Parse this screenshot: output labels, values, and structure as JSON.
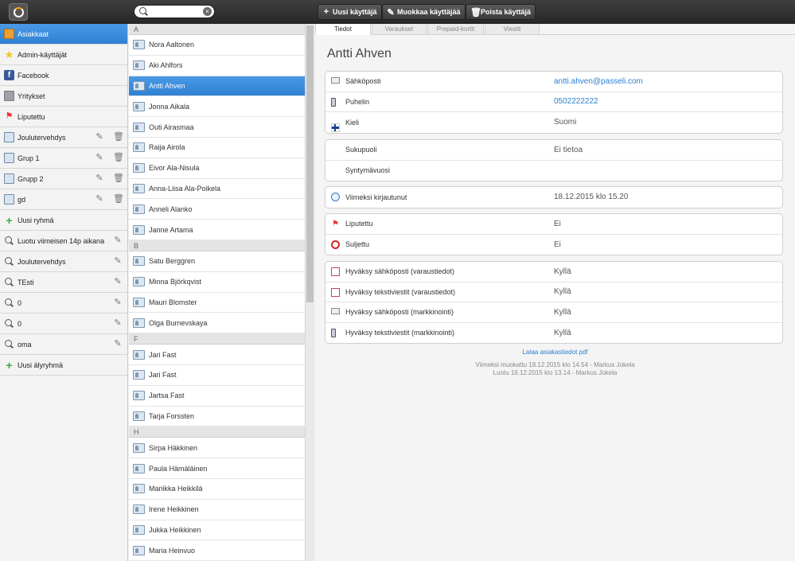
{
  "toolbar": {
    "search_placeholder": "",
    "search_value": "",
    "clear": "×",
    "new_user": "Uusi käyttäjä",
    "edit_user": "Muokkaa käyttäjää",
    "delete_user": "Poista käyttäjä"
  },
  "sidebar": {
    "items": [
      {
        "label": "Asiakkaat",
        "icon": "address-book-icon"
      },
      {
        "label": "Admin-käyttäjät",
        "icon": "star-icon"
      },
      {
        "label": "Facebook",
        "icon": "facebook-icon"
      },
      {
        "label": "Yritykset",
        "icon": "building-icon"
      },
      {
        "label": "Liputettu",
        "icon": "flag-icon"
      },
      {
        "label": "Joulutervehdys",
        "icon": "group-icon"
      },
      {
        "label": "Grup 1",
        "icon": "group-icon"
      },
      {
        "label": "Grupp 2",
        "icon": "group-icon"
      },
      {
        "label": "gd",
        "icon": "group-icon"
      },
      {
        "label": "Uusi ryhmä",
        "icon": "plus-icon"
      },
      {
        "label": "Luotu viimeisen 14p aikana",
        "icon": "magnifier-icon"
      },
      {
        "label": "Joulutervehdys",
        "icon": "magnifier-icon"
      },
      {
        "label": "TEsti",
        "icon": "magnifier-icon"
      },
      {
        "label": "0",
        "icon": "magnifier-icon"
      },
      {
        "label": "0",
        "icon": "magnifier-icon"
      },
      {
        "label": "oma",
        "icon": "magnifier-icon"
      },
      {
        "label": "Uusi älyryhmä",
        "icon": "plus-icon"
      }
    ]
  },
  "contacts": {
    "groups": [
      {
        "letter": "A",
        "names": [
          "Nora Aaltonen",
          "Aki Ahlfors",
          "Antti Ahven",
          "Jonna Aikala",
          "Outi Airasmaa",
          "Raija Airola",
          "Eivor Ala-Nisula",
          "Anna-Liisa Ala-Poikela",
          "Anneli Alanko",
          "Janne Artama"
        ]
      },
      {
        "letter": "B",
        "names": [
          "Satu Berggren",
          "Minna Björkqvist",
          "Mauri Blomster",
          "Olga Burnevskaya"
        ]
      },
      {
        "letter": "F",
        "names": [
          "Jari Fast",
          "Jari Fast",
          "Jartsa Fast",
          "Tarja Forssten"
        ]
      },
      {
        "letter": "H",
        "names": [
          "Sirpa Häkkinen",
          "Paula Hämäläinen",
          "Mariikka Heikkilä",
          "Irene Heikkinen",
          "Jukka Heikkinen",
          "Maria Heinvuo"
        ]
      }
    ],
    "selected": "Antti Ahven"
  },
  "tabs": [
    "Tiedot",
    "Varaukset",
    "Prepaid-kortit",
    "Viestit"
  ],
  "detail": {
    "name": "Antti Ahven",
    "contact": [
      {
        "label": "Sähköposti",
        "value": "antti.ahven@passeli.com",
        "icon": "mail-icon"
      },
      {
        "label": "Puhelin",
        "value": "0502222222",
        "icon": "phone-icon"
      },
      {
        "label": "Kieli",
        "value": "Suomi",
        "icon": "finland-flag-icon"
      }
    ],
    "personal": [
      {
        "label": "Sukupuoli",
        "value": "Ei tietoa"
      },
      {
        "label": "Syntymävuosi",
        "value": ""
      }
    ],
    "login": [
      {
        "label": "Viimeksi kirjautunut",
        "value": "18.12.2015 klo 15.20",
        "icon": "clock-icon"
      }
    ],
    "status": [
      {
        "label": "Liputettu",
        "value": "Ei",
        "icon": "flag-icon"
      },
      {
        "label": "Suljettu",
        "value": "Ei",
        "icon": "blocked-icon"
      }
    ],
    "consents": [
      {
        "label": "Hyväksy sähköposti (varaustiedot)",
        "value": "Kyllä",
        "icon": "mail-calendar-icon"
      },
      {
        "label": "Hyväksy tekstiviestit (varaustiedot)",
        "value": "Kyllä",
        "icon": "phone-calendar-icon"
      },
      {
        "label": "Hyväksy sähköposti (markkinointi)",
        "value": "Kyllä",
        "icon": "mail-marketing-icon"
      },
      {
        "label": "Hyväksy tekstiviestit (markkinointi)",
        "value": "Kyllä",
        "icon": "phone-marketing-icon"
      }
    ],
    "pdf_link": "Lataa asiakastiedot pdf",
    "modified": "Viimeksi muokattu 18.12.2015 klo 14.54 - Markus Jokela",
    "created": "Luotu 16.12.2015 klo 13.14 - Markus Jokela"
  }
}
